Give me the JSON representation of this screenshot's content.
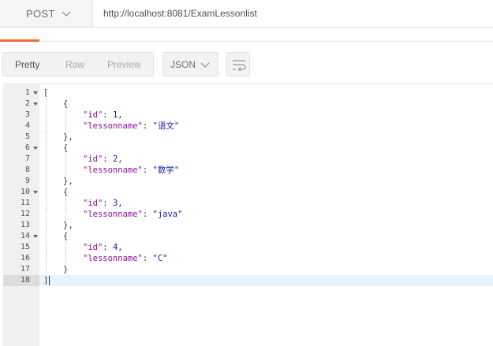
{
  "request": {
    "method": "POST",
    "url": "http://localhost:8081/ExamLessonlist"
  },
  "toolbar": {
    "tabs": {
      "pretty": "Pretty",
      "raw": "Raw",
      "preview": "Preview"
    },
    "format": "JSON"
  },
  "colors": {
    "accent": "#f26b3a",
    "key": "#881391",
    "value": "#1a1aa6"
  },
  "icons": {
    "method_chevron": "chevron-down-icon",
    "format_chevron": "chevron-down-icon",
    "wrap": "wrap-lines-icon",
    "fold": "fold-arrow-icon"
  },
  "response": {
    "lines": [
      {
        "n": "1",
        "text": "["
      },
      {
        "n": "2",
        "text": "{"
      },
      {
        "n": "3",
        "key": "\"id\"",
        "val": "1,"
      },
      {
        "n": "4",
        "key": "\"lessonname\"",
        "val": "\"语文\""
      },
      {
        "n": "5",
        "text": "},"
      },
      {
        "n": "6",
        "text": "{"
      },
      {
        "n": "7",
        "key": "\"id\"",
        "val": "2,"
      },
      {
        "n": "8",
        "key": "\"lessonname\"",
        "val": "\"数学\""
      },
      {
        "n": "9",
        "text": "},"
      },
      {
        "n": "10",
        "text": "{"
      },
      {
        "n": "11",
        "key": "\"id\"",
        "val": "3,"
      },
      {
        "n": "12",
        "key": "\"lessonname\"",
        "val": "\"java\""
      },
      {
        "n": "13",
        "text": "},"
      },
      {
        "n": "14",
        "text": "{"
      },
      {
        "n": "15",
        "key": "\"id\"",
        "val": "4,"
      },
      {
        "n": "16",
        "key": "\"lessonname\"",
        "val": "\"C\""
      },
      {
        "n": "17",
        "text": "}"
      },
      {
        "n": "18",
        "text": "]"
      }
    ]
  }
}
